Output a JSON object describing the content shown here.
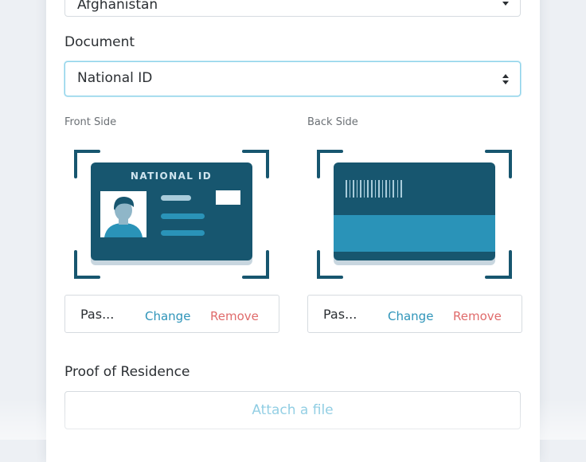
{
  "country": {
    "value": "Afghanistan"
  },
  "document": {
    "label": "Document",
    "value": "National ID"
  },
  "front": {
    "label": "Front Side",
    "card_title": "NATIONAL ID",
    "file_name": "Pas...",
    "change_label": "Change",
    "remove_label": "Remove"
  },
  "back": {
    "label": "Back Side",
    "file_name": "Pas...",
    "change_label": "Change",
    "remove_label": "Remove"
  },
  "proof": {
    "label": "Proof of Residence",
    "attach_label": "Attach a file"
  },
  "colors": {
    "card_dark": "#17566f",
    "card_stripe": "#2a93b8",
    "link_blue": "#2e94b9",
    "remove_red": "#e06b6b",
    "focus_border": "#8fd3ea"
  }
}
